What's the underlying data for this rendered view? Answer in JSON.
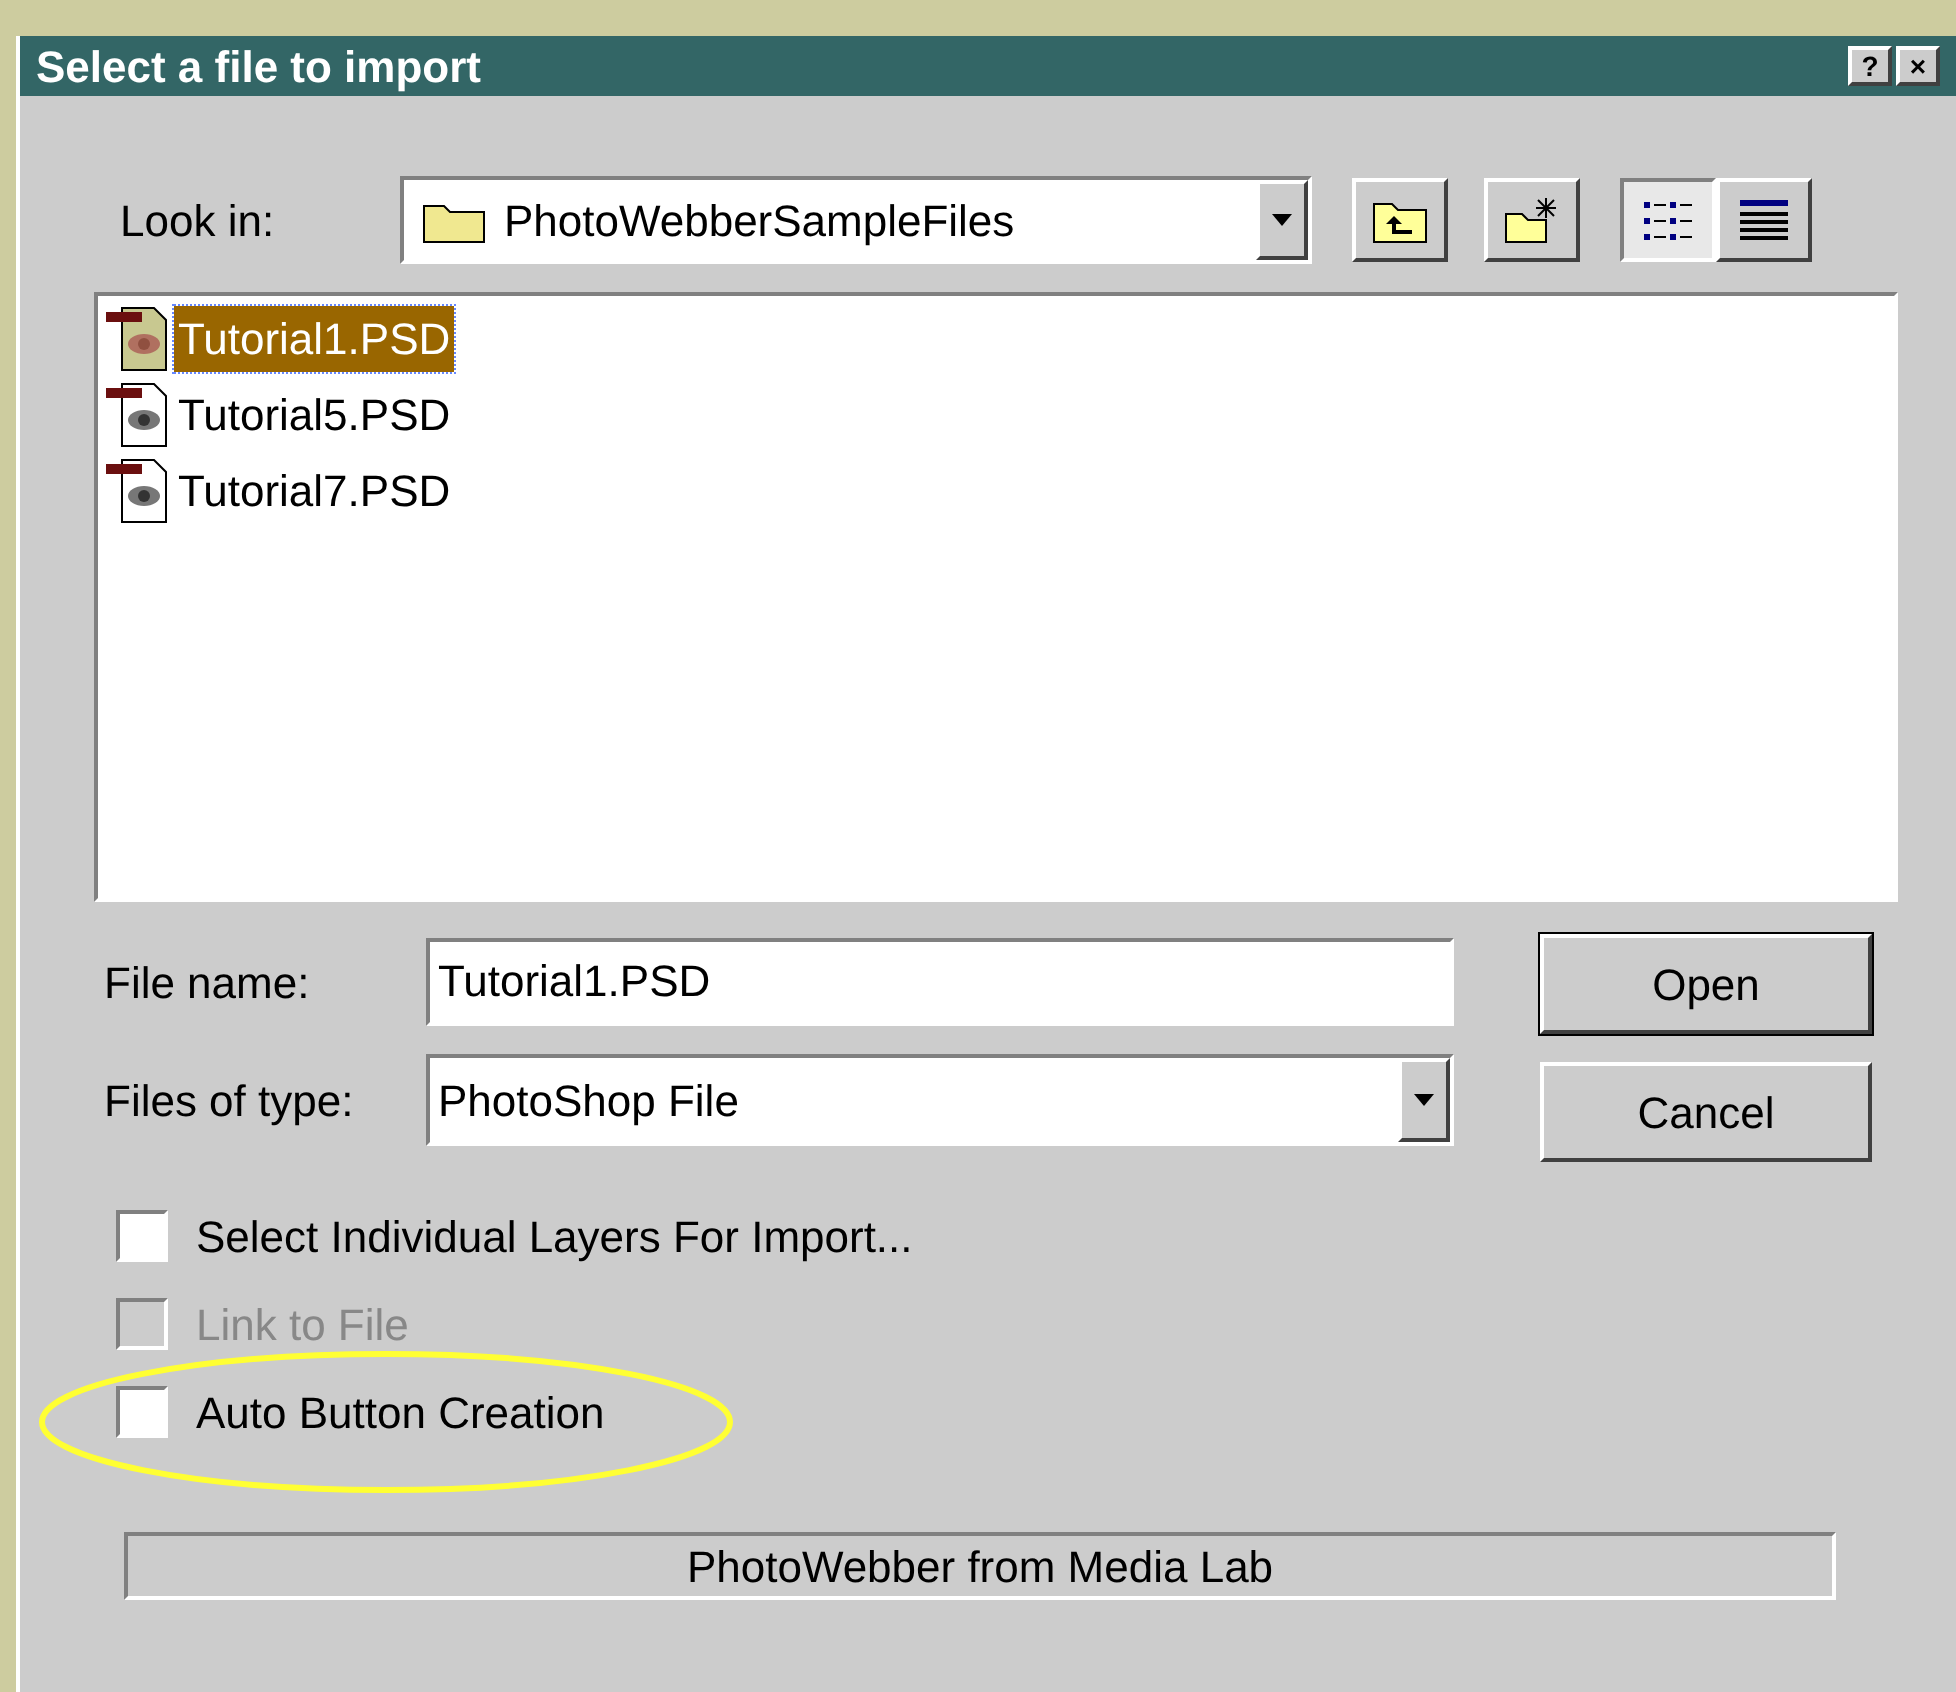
{
  "window": {
    "title": "Select a file to import",
    "controls": [
      "?",
      "×"
    ]
  },
  "look_in": {
    "label": "Look in:",
    "value": "PhotoWebberSampleFiles"
  },
  "files": [
    {
      "name": "Tutorial1.PSD",
      "selected": true
    },
    {
      "name": "Tutorial5.PSD",
      "selected": false
    },
    {
      "name": "Tutorial7.PSD",
      "selected": false
    }
  ],
  "file_name": {
    "label": "File name:",
    "value": "Tutorial1.PSD"
  },
  "file_type": {
    "label": "Files of type:",
    "value": "PhotoShop File"
  },
  "buttons": [
    "Open",
    "Cancel"
  ],
  "options": [
    {
      "label": "Select Individual Layers For Import...",
      "checked": false,
      "disabled": false
    },
    {
      "label": "Link to File",
      "checked": false,
      "disabled": true
    },
    {
      "label": "Auto Button Creation",
      "checked": false,
      "disabled": false
    }
  ],
  "status_bar": "PhotoWebber from Media Lab"
}
